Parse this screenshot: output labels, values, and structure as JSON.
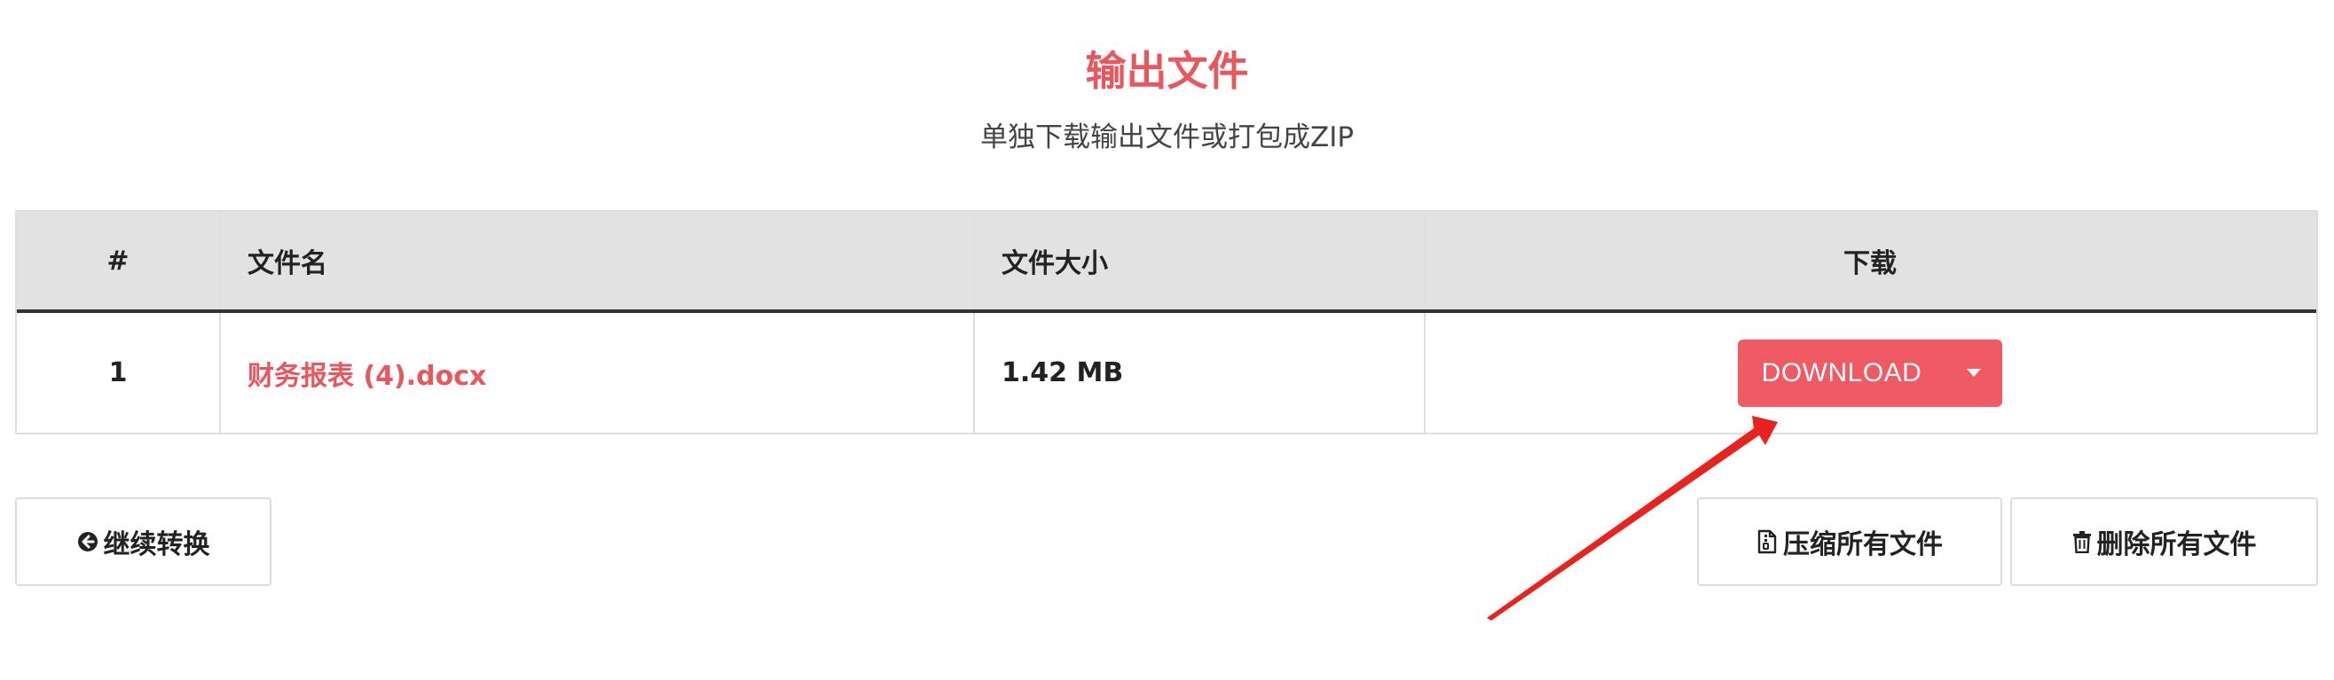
{
  "header": {
    "title": "输出文件",
    "subtitle": "单独下载输出文件或打包成ZIP"
  },
  "table": {
    "columns": [
      "#",
      "文件名",
      "文件大小",
      "下载"
    ],
    "rows": [
      {
        "index": "1",
        "filename": "财务报表 (4).docx",
        "size": "1.42 MB",
        "download_label": "DOWNLOAD"
      }
    ]
  },
  "actions": {
    "continue_label": "继续转换",
    "zip_label": "压缩所有文件",
    "delete_label": "删除所有文件"
  },
  "colors": {
    "accent": "#e8565e",
    "download_button": "#f05a64",
    "annotation_arrow": "#e8231e"
  },
  "icons": {
    "continue": "circle-arrow-left-icon",
    "zip": "file-zip-icon",
    "delete": "trash-icon",
    "dropdown": "caret-down-icon"
  }
}
